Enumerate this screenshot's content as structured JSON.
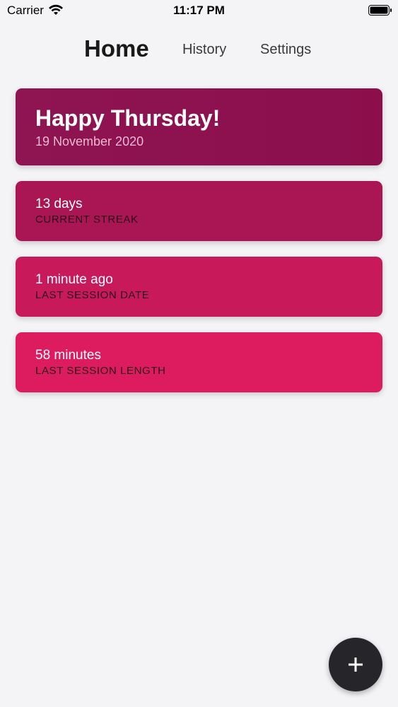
{
  "status_bar": {
    "carrier": "Carrier",
    "time": "11:17 PM",
    "wifi_icon": "wifi-icon",
    "battery_icon": "battery-icon"
  },
  "nav": {
    "tabs": [
      {
        "label": "Home",
        "active": true
      },
      {
        "label": "History",
        "active": false
      },
      {
        "label": "Settings",
        "active": false
      }
    ]
  },
  "greeting": {
    "title": "Happy Thursday!",
    "date": "19 November 2020"
  },
  "stats": [
    {
      "value": "13 days",
      "label": "CURRENT STREAK"
    },
    {
      "value": "1 minute ago",
      "label": "LAST SESSION DATE"
    },
    {
      "value": "58 minutes",
      "label": "LAST SESSION LENGTH"
    }
  ],
  "fab": {
    "icon": "plus-icon"
  },
  "colors": {
    "background": "#f4f4f6",
    "greeting_card": "#8c0f4c",
    "streak_card": "#aa1554",
    "last_date_card": "#c81a5a",
    "length_card": "#dc1c5f",
    "fab": "#26262a"
  }
}
